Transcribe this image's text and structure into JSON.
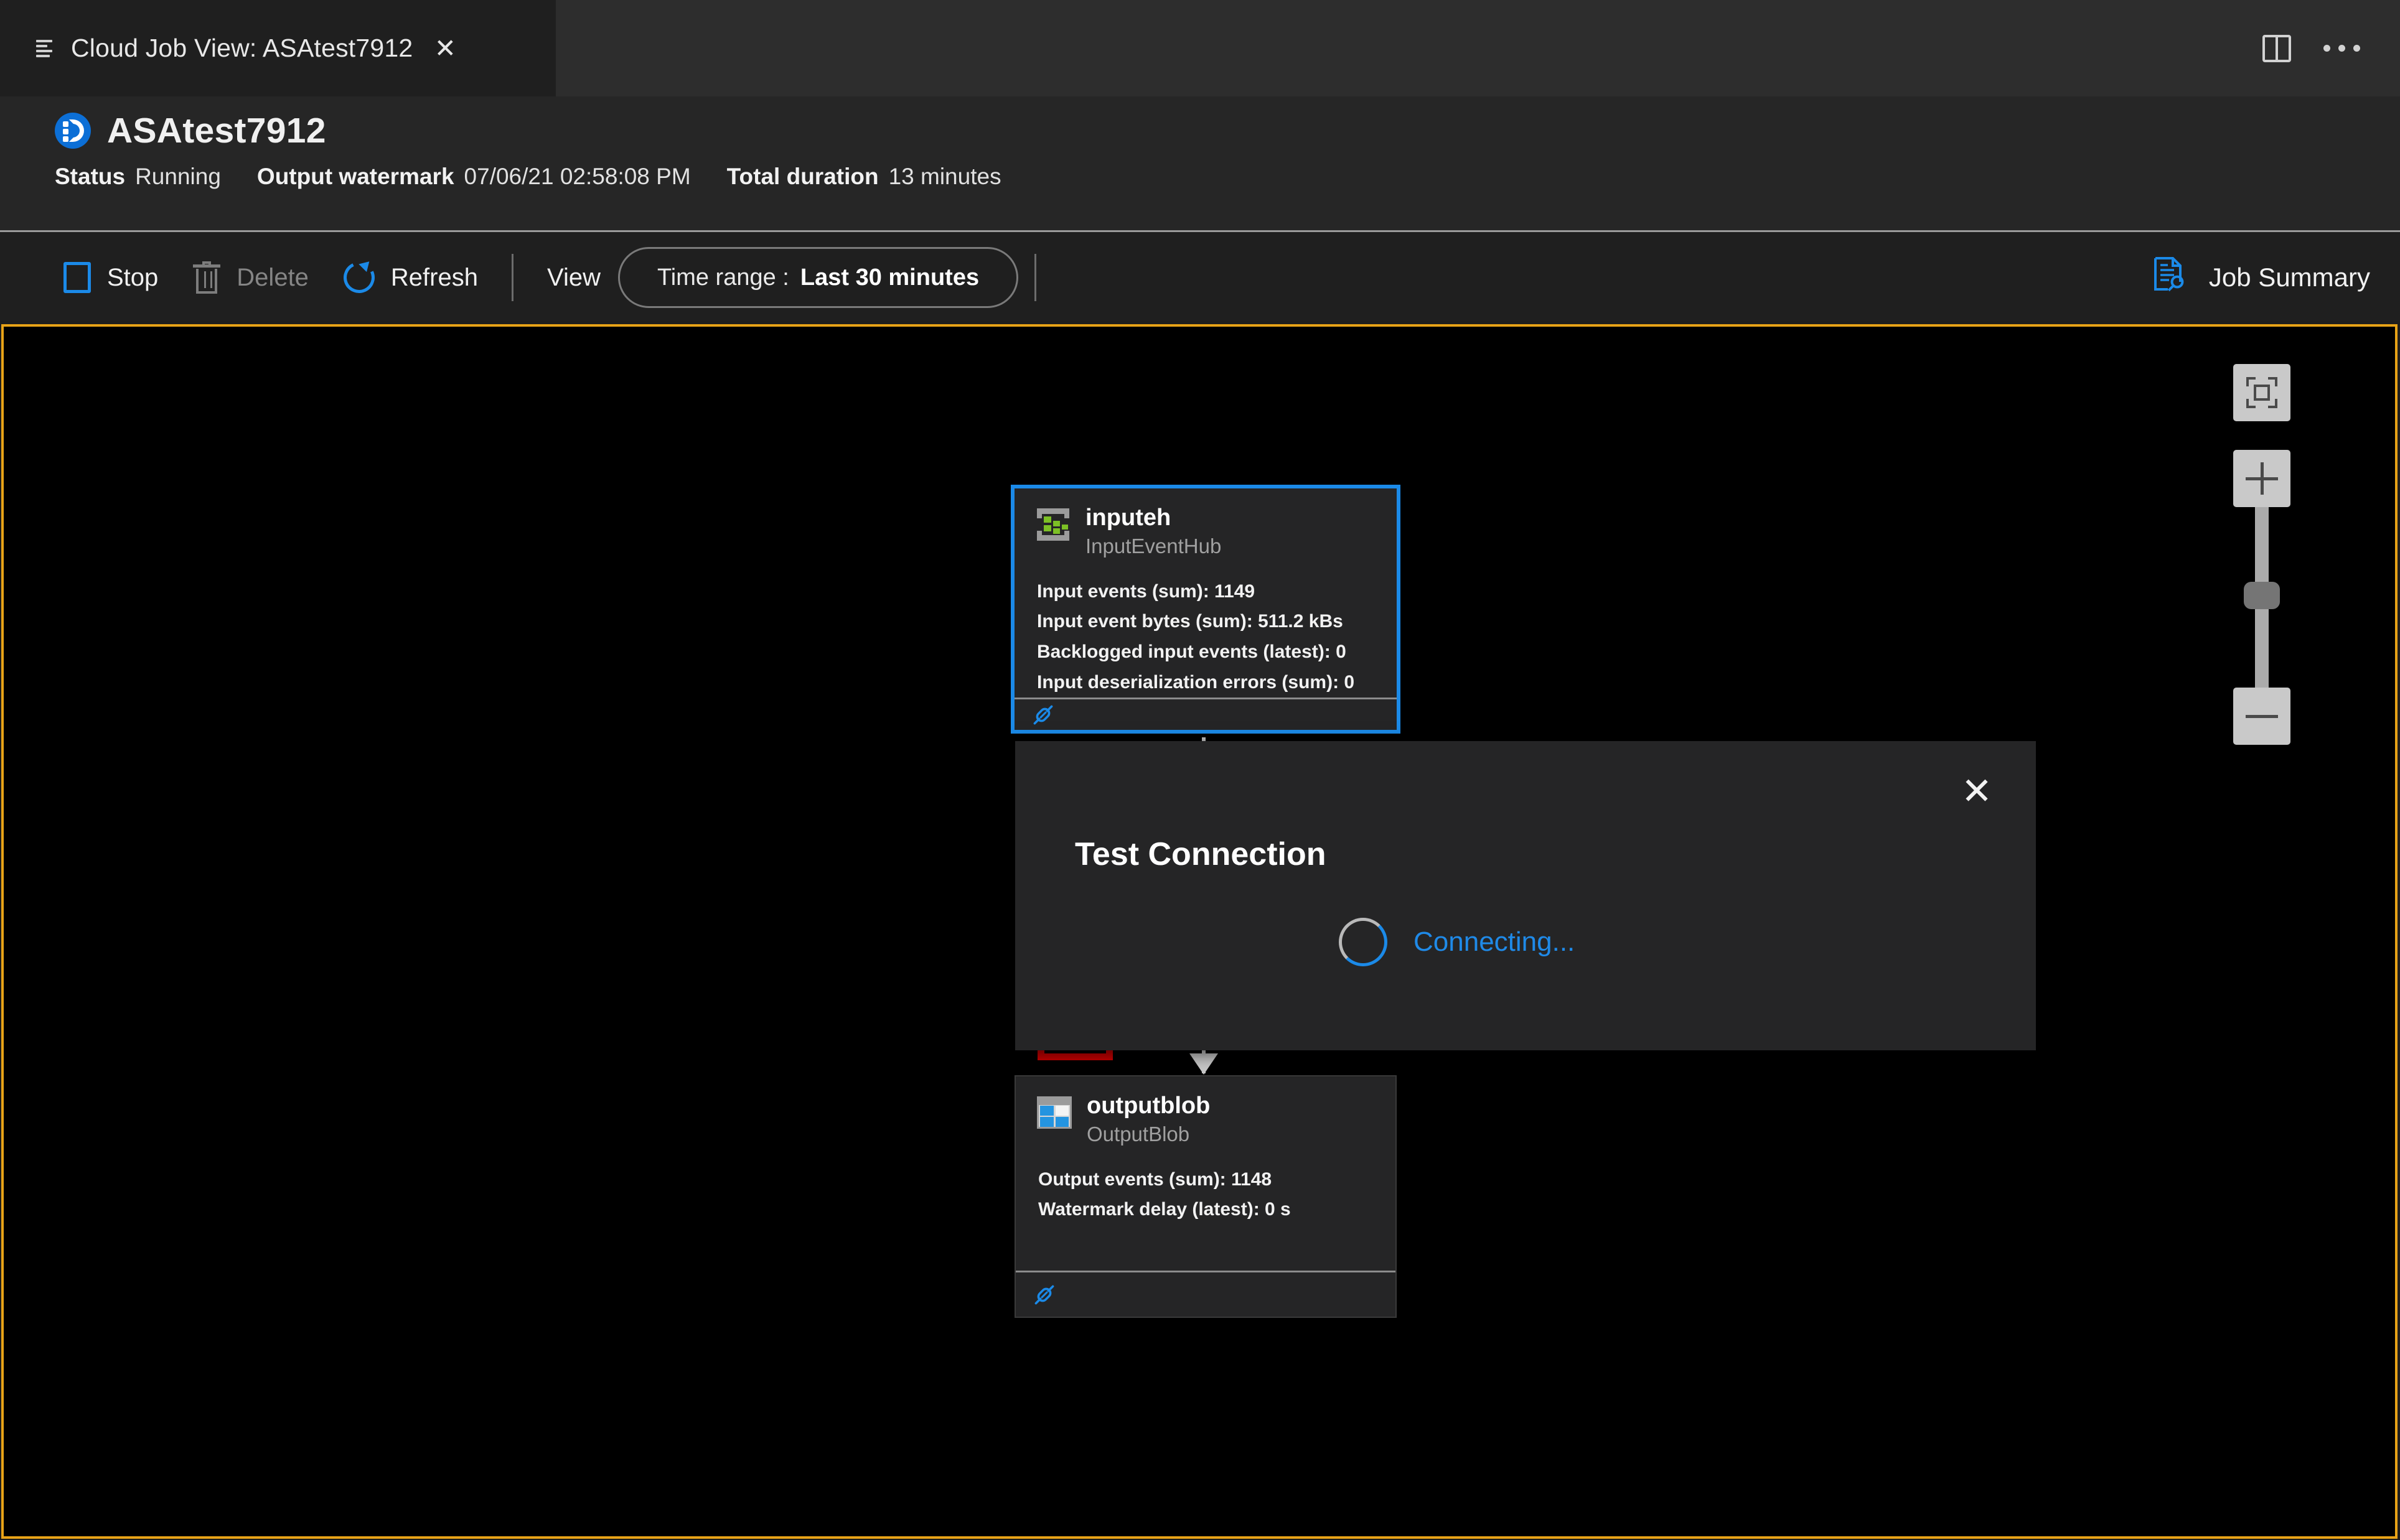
{
  "tab": {
    "menu_icon": "hamburger-icon",
    "title": "Cloud Job View: ASAtest7912",
    "close_label": "✕",
    "split_editor_icon": "split-editor-icon",
    "more_actions_icon": "ellipsis-icon"
  },
  "header": {
    "job_icon": "stream-analytics-job-icon",
    "job_name": "ASAtest7912",
    "status_key": "Status",
    "status_value": "Running",
    "watermark_key": "Output watermark",
    "watermark_value": "07/06/21 02:58:08 PM",
    "duration_key": "Total duration",
    "duration_value": "13 minutes"
  },
  "toolbar": {
    "stop_label": "Stop",
    "delete_label": "Delete",
    "refresh_label": "Refresh",
    "view_label": "View",
    "timerange_label": "Time range :",
    "timerange_value": "Last 30 minutes",
    "job_summary_label": "Job Summary"
  },
  "canvas": {
    "focus_border_color": "#e8a317",
    "background_color": "#000000",
    "input_node": {
      "name": "inputeh",
      "type": "InputEventHub",
      "icon": "event-hub-icon",
      "metrics": [
        "Input events (sum): 1149",
        "Input event bytes (sum): 511.2 kBs",
        "Backlogged input events (latest): 0",
        "Input deserialization errors (sum): 0"
      ],
      "test_connection_icon": "plug-icon",
      "selected_border_color": "#1b8ae8"
    },
    "output_node": {
      "name": "outputblob",
      "type": "OutputBlob",
      "icon": "blob-storage-icon",
      "metrics": [
        "Output events (sum): 1148",
        "Watermark delay (latest): 0 s"
      ],
      "test_connection_icon": "plug-icon"
    },
    "annotation": {
      "shape": "rectangle",
      "color": "#cc0000",
      "target": "input-node-test-connection-icon"
    }
  },
  "dialog": {
    "title": "Test Connection",
    "status_text": "Connecting...",
    "close_label": "✕",
    "spinner_color": "#1b8ae8"
  },
  "zoom_controls": {
    "fit_label": "fit-to-screen-icon",
    "zoom_in_label": "plus-icon",
    "zoom_out_label": "minus-icon",
    "slider_label": "zoom-slider"
  }
}
